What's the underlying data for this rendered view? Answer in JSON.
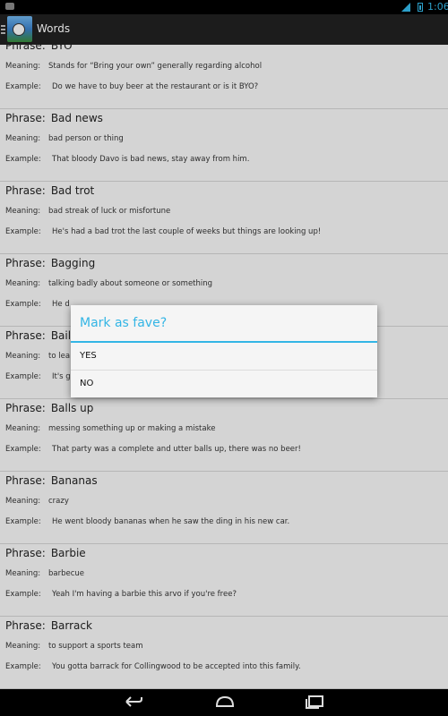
{
  "status_bar": {
    "time": "1:06",
    "signal_label": "3G"
  },
  "action_bar": {
    "title": "Words"
  },
  "labels": {
    "phrase": "Phrase:",
    "meaning": "Meaning:",
    "example": "Example:"
  },
  "entries": [
    {
      "phrase": "BYO",
      "meaning": "Stands for “Bring your own” generally regarding alcohol",
      "example": "Do we have to buy beer at the restaurant or is it BYO?"
    },
    {
      "phrase": "Bad news",
      "meaning": "bad person or thing",
      "example": "That bloody Davo is bad news, stay away from him."
    },
    {
      "phrase": "Bad trot",
      "meaning": "bad streak of luck or misfortune",
      "example": "He's had a bad trot the last couple of weeks but things are looking up!"
    },
    {
      "phrase": "Bagging",
      "meaning": "talking badly about someone or something",
      "example": "He d"
    },
    {
      "phrase": "Bail",
      "meaning": "to lea",
      "example": "It's g"
    },
    {
      "phrase": "Balls up",
      "meaning": "messing something up or making a mistake",
      "example": "That party was a complete and utter balls up, there was no beer!"
    },
    {
      "phrase": "Bananas",
      "meaning": "crazy",
      "example": "He went bloody bananas when he saw the ding in his new car."
    },
    {
      "phrase": "Barbie",
      "meaning": "barbecue",
      "example": "Yeah I'm having a barbie this arvo if you're free?"
    },
    {
      "phrase": "Barrack",
      "meaning": "to support a sports team",
      "example": "You gotta barrack for Collingwood to be accepted into this family."
    }
  ],
  "dialog": {
    "title": "Mark as fave?",
    "yes_label": "YES",
    "no_label": "NO"
  },
  "colors": {
    "accent": "#33b5e5",
    "action_bar": "#202020",
    "background": "#f2f2f2"
  },
  "icons": {
    "back": "back-icon",
    "home": "home-icon",
    "recents": "recents-icon"
  }
}
